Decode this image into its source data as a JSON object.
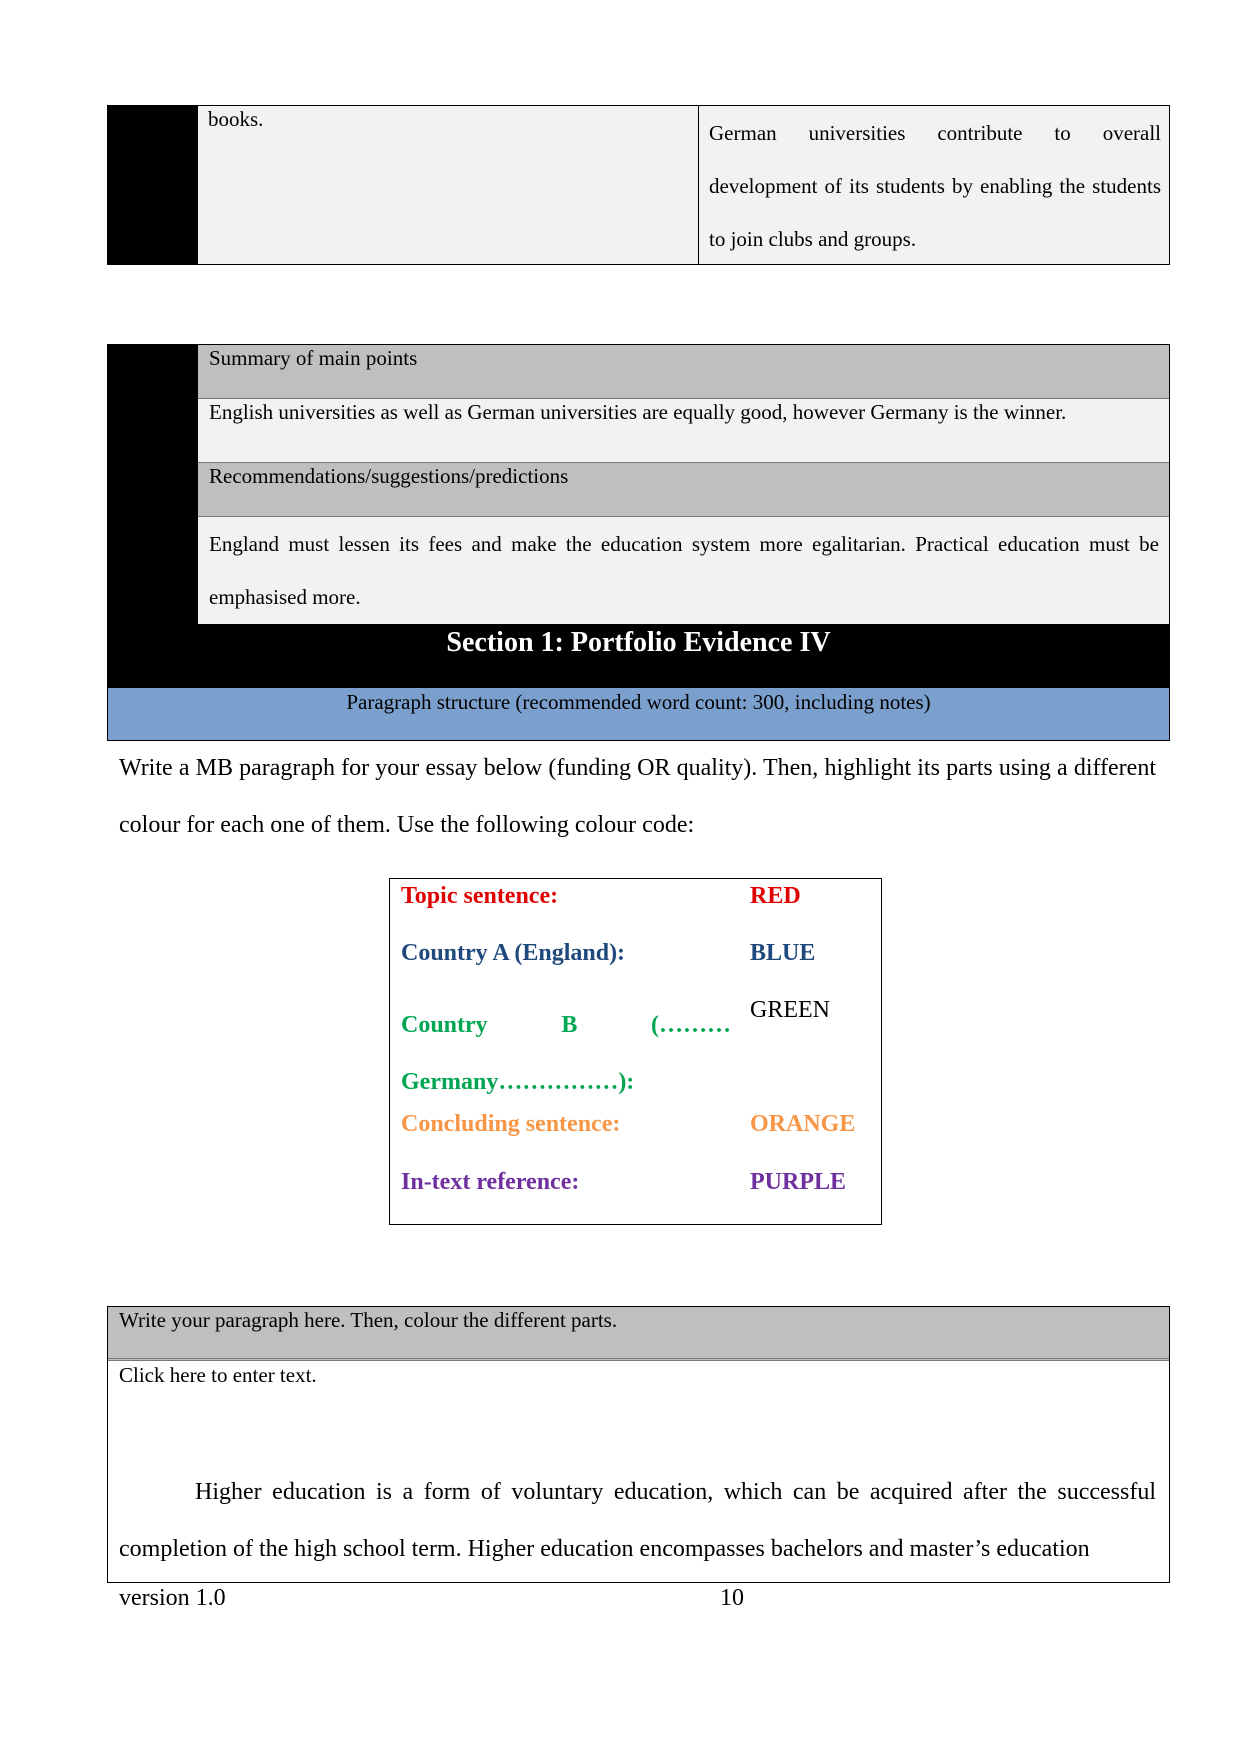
{
  "top_table": {
    "left_cell": "books.",
    "right_cell": "German universities contribute to overall development of its students by enabling the students to join clubs and groups."
  },
  "summary_table": {
    "rows": [
      {
        "text": "Summary of main points",
        "type": "header"
      },
      {
        "text": "English universities as well as German universities are equally good, however Germany is the winner.",
        "type": "body"
      },
      {
        "text": "Recommendations/suggestions/predictions",
        "type": "header"
      },
      {
        "text": "England must lessen its fees and make the education system more egalitarian. Practical education must be emphasised more.",
        "type": "body"
      }
    ]
  },
  "section": {
    "title": "Section 1: Portfolio Evidence IV",
    "subtitle": "Paragraph structure (recommended word count: 300, including notes)"
  },
  "instructions": "Write a MB paragraph for your essay below (funding OR quality). Then, highlight its parts using a different colour for each one of them. Use the following colour code:",
  "colour_code": [
    {
      "label": "Topic sentence:",
      "colour_name": "RED",
      "colour": "#e00000",
      "value_colour": "#e00000",
      "bold_value": true
    },
    {
      "label": "Country A (England):",
      "colour_name": "BLUE",
      "colour": "#1f497d",
      "value_colour": "#1f497d",
      "bold_value": true
    },
    {
      "label": "Country B (……… Germany……………):",
      "colour_name": "GREEN",
      "colour": "#00a651",
      "value_colour": "#000000",
      "bold_value": false
    },
    {
      "label": "Concluding sentence:",
      "colour_name": "ORANGE",
      "colour": "#f79646",
      "value_colour": "#f79646",
      "bold_value": true
    },
    {
      "label": "In-text reference:",
      "colour_name": "PURPLE",
      "colour": "#7030a0",
      "value_colour": "#7030a0",
      "bold_value": true
    }
  ],
  "paragraph_box": {
    "header": "Write your paragraph here. Then, colour the different parts.",
    "placeholder": "Click here to enter text.",
    "text": "Higher education is a form of voluntary education, which can be acquired after the successful completion of the high school term. Higher education encompasses bachelors and master’s education"
  },
  "footer": {
    "version": "version 1.0",
    "page_number": "10"
  },
  "colors": {
    "header_grey": "#bfbfbf",
    "cell_grey": "#f2f2f2",
    "section_blue": "#7ba0cd",
    "black": "#000000"
  }
}
